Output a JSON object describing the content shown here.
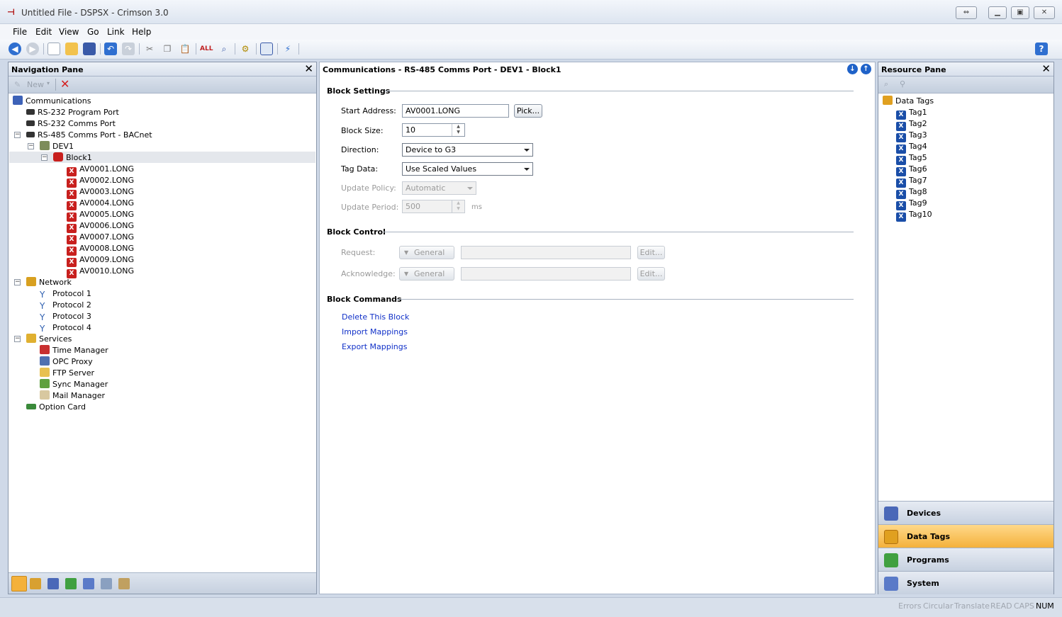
{
  "window": {
    "title": "Untitled File - DSPSX - Crimson 3.0"
  },
  "menu": [
    "File",
    "Edit",
    "View",
    "Go",
    "Link",
    "Help"
  ],
  "nav_pane": {
    "title": "Navigation Pane",
    "new_label": "New",
    "tree": {
      "communications": "Communications",
      "rs232_program": "RS-232 Program Port",
      "rs232_comms": "RS-232 Comms Port",
      "rs485_comms": "RS-485 Comms Port - BACnet",
      "dev1": "DEV1",
      "block1": "Block1",
      "mappings": [
        "AV0001.LONG",
        "AV0002.LONG",
        "AV0003.LONG",
        "AV0004.LONG",
        "AV0005.LONG",
        "AV0006.LONG",
        "AV0007.LONG",
        "AV0008.LONG",
        "AV0009.LONG",
        "AV0010.LONG"
      ],
      "network": "Network",
      "protocols": [
        "Protocol 1",
        "Protocol 2",
        "Protocol 3",
        "Protocol 4"
      ],
      "services": "Services",
      "service_items": [
        "Time Manager",
        "OPC Proxy",
        "FTP Server",
        "Sync Manager",
        "Mail Manager"
      ],
      "option_card": "Option Card"
    }
  },
  "main": {
    "title": "Communications - RS-485 Comms Port - DEV1 - Block1",
    "block_settings": {
      "title": "Block Settings",
      "start_address_label": "Start Address:",
      "start_address_value": "AV0001.LONG",
      "pick_label": "Pick...",
      "block_size_label": "Block Size:",
      "block_size_value": "10",
      "direction_label": "Direction:",
      "direction_value": "Device to G3",
      "tag_data_label": "Tag Data:",
      "tag_data_value": "Use Scaled Values",
      "update_policy_label": "Update Policy:",
      "update_policy_value": "Automatic",
      "update_period_label": "Update Period:",
      "update_period_value": "500",
      "update_period_unit": "ms"
    },
    "block_control": {
      "title": "Block Control",
      "request_label": "Request:",
      "request_type": "General",
      "acknowledge_label": "Acknowledge:",
      "acknowledge_type": "General",
      "edit_label": "Edit..."
    },
    "block_commands": {
      "title": "Block Commands",
      "links": [
        "Delete This Block",
        "Import Mappings",
        "Export Mappings"
      ]
    }
  },
  "resource_pane": {
    "title": "Resource Pane",
    "root": "Data Tags",
    "tags": [
      "Tag1",
      "Tag2",
      "Tag3",
      "Tag4",
      "Tag5",
      "Tag6",
      "Tag7",
      "Tag8",
      "Tag9",
      "Tag10"
    ],
    "categories": [
      "Devices",
      "Data Tags",
      "Programs",
      "System"
    ],
    "active_category": "Data Tags"
  },
  "status": {
    "items": [
      "Errors",
      "Circular",
      "Translate",
      "READ",
      "CAPS",
      "NUM"
    ],
    "active": "NUM"
  },
  "colors": {
    "accent_active": "#f4b13b",
    "link": "#1030c8",
    "error_icon": "#c8201e",
    "tag_icon": "#1a4ea8"
  }
}
